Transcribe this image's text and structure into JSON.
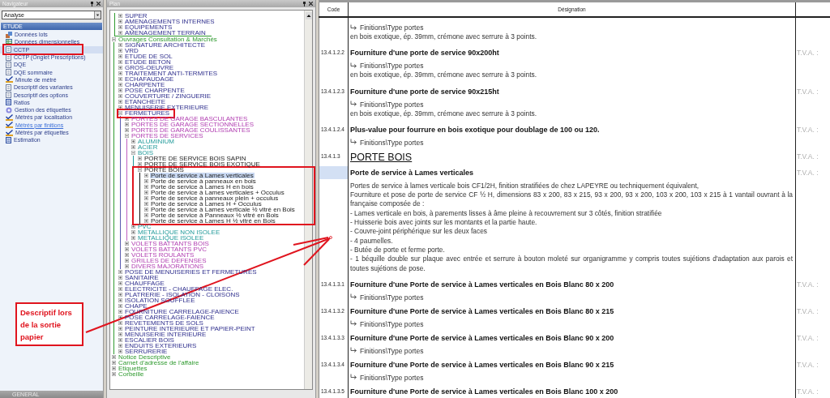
{
  "navigator": {
    "title": "Navigateur",
    "dropdown": {
      "value": "Analyse"
    },
    "section": "ETUDE",
    "items": [
      {
        "label": "Données lots",
        "kind": "lots",
        "selected": false,
        "hovered": false
      },
      {
        "label": "Données dimensionnelles",
        "kind": "grid",
        "selected": false,
        "hovered": false
      },
      {
        "label": "CCTP",
        "kind": "doc",
        "selected": true,
        "hovered": false
      },
      {
        "label": "CCTP (Onglet Prescriptions)",
        "kind": "doc",
        "selected": false,
        "hovered": false
      },
      {
        "label": "DQE",
        "kind": "doc",
        "selected": false,
        "hovered": false
      },
      {
        "label": "DQE sommaire",
        "kind": "doc",
        "selected": false,
        "hovered": false
      },
      {
        "label": "Minute de métré",
        "kind": "measure",
        "selected": false,
        "hovered": false
      },
      {
        "label": "Descriptif des variantes",
        "kind": "doc",
        "selected": false,
        "hovered": false
      },
      {
        "label": "Descriptif des options",
        "kind": "doc",
        "selected": false,
        "hovered": false
      },
      {
        "label": "Ratios",
        "kind": "list",
        "selected": false,
        "hovered": false
      },
      {
        "label": "Gestion des étiquettes",
        "kind": "tag",
        "selected": false,
        "hovered": false
      },
      {
        "label": "Métrés par localisation",
        "kind": "measure",
        "selected": false,
        "hovered": false
      },
      {
        "label": "Métrés par finitions",
        "kind": "measure",
        "selected": false,
        "hovered": true
      },
      {
        "label": "Métrés par étiquettes",
        "kind": "measure",
        "selected": false,
        "hovered": false
      },
      {
        "label": "Estimation",
        "kind": "list",
        "selected": false,
        "hovered": false
      }
    ],
    "footer": "GENERAL"
  },
  "plan": {
    "title": "Plan",
    "top_items": [
      {
        "label": "SUPER",
        "expanded": false,
        "selected": false
      },
      {
        "label": "AMENAGEMENTS INTERNES",
        "expanded": false,
        "selected": false
      },
      {
        "label": "EQUIPEMENTS",
        "expanded": false,
        "selected": false
      },
      {
        "label": "AMENAGEMENT TERRAIN",
        "expanded": false,
        "selected": false
      }
    ],
    "tree": [
      {
        "label": "Ouvrages Consultation & Marchés",
        "expanded": true,
        "selected": false,
        "children": [
          {
            "label": "SIGNATURE ARCHITECTE",
            "expanded": false,
            "selected": false
          },
          {
            "label": "VRD",
            "expanded": false,
            "selected": false
          },
          {
            "label": "ETUDE DE SOL",
            "expanded": false,
            "selected": false
          },
          {
            "label": "ETUDE BETON",
            "expanded": false,
            "selected": false
          },
          {
            "label": "GROS-OEUVRE",
            "expanded": false,
            "selected": false
          },
          {
            "label": "TRAITEMENT ANTI-TERMITES",
            "expanded": false,
            "selected": false
          },
          {
            "label": "ECHAFAUDAGE",
            "expanded": false,
            "selected": false
          },
          {
            "label": "CHARPENTE",
            "expanded": false,
            "selected": false
          },
          {
            "label": "POSE CHARPENTE",
            "expanded": false,
            "selected": false
          },
          {
            "label": "COUVERTURE / ZINGUERIE",
            "expanded": false,
            "selected": false
          },
          {
            "label": "ETANCHEITE",
            "expanded": false,
            "selected": false
          },
          {
            "label": "MENUISERIE EXTERIEURE",
            "expanded": false,
            "selected": false
          },
          {
            "label": "FERMETURES",
            "expanded": true,
            "selected": false,
            "children": [
              {
                "label": "PORTES DE GARAGE BASCULANTES",
                "expanded": false,
                "selected": false
              },
              {
                "label": "PORTES DE GARAGE SECTIONNELLES",
                "expanded": false,
                "selected": false
              },
              {
                "label": "PORTES DE GARAGE COULISSANTES",
                "expanded": false,
                "selected": false
              },
              {
                "label": "PORTES DE SERVICES",
                "expanded": true,
                "selected": false,
                "children": [
                  {
                    "label": "ALUMINIUM",
                    "expanded": false,
                    "selected": false
                  },
                  {
                    "label": "ACIER",
                    "expanded": false,
                    "selected": false
                  },
                  {
                    "label": "BOIS",
                    "expanded": true,
                    "selected": false,
                    "children": [
                      {
                        "label": "PORTE DE SERVICE BOIS SAPIN",
                        "expanded": false,
                        "selected": false
                      },
                      {
                        "label": "PORTE DE SERVICE BOIS EXOTIQUE",
                        "expanded": false,
                        "selected": false
                      },
                      {
                        "label": "PORTE BOIS",
                        "expanded": true,
                        "selected": false,
                        "children": [
                          {
                            "label": "Porte de service à Lames verticales",
                            "expanded": false,
                            "selected": true
                          },
                          {
                            "label": "Porte de service à panneaux en bois",
                            "expanded": false,
                            "selected": false
                          },
                          {
                            "label": "Porte de service à Lames H en bois",
                            "expanded": false,
                            "selected": false
                          },
                          {
                            "label": "Porte de service à Lames verticales + Occulus",
                            "expanded": false,
                            "selected": false
                          },
                          {
                            "label": "Porte de service à panneaux plein + occulus",
                            "expanded": false,
                            "selected": false
                          },
                          {
                            "label": "Porte de service à Lames H + Occulus",
                            "expanded": false,
                            "selected": false
                          },
                          {
                            "label": "Porte de service à Lames verticale ½ vitré en Bois",
                            "expanded": false,
                            "selected": false
                          },
                          {
                            "label": "Porte de service à Panneaux ½ vitré en Bois",
                            "expanded": false,
                            "selected": false
                          },
                          {
                            "label": "Porte de service à Lames H ½ vitré en Bois",
                            "expanded": false,
                            "selected": false
                          }
                        ]
                      }
                    ]
                  },
                  {
                    "label": "PVC",
                    "expanded": false,
                    "selected": false
                  },
                  {
                    "label": "METALLIQUE NON ISOLEE",
                    "expanded": false,
                    "selected": false
                  },
                  {
                    "label": "METALLIQUE ISOLEE",
                    "expanded": false,
                    "selected": false
                  }
                ]
              },
              {
                "label": "VOLETS BATTANTS BOIS",
                "expanded": false,
                "selected": false
              },
              {
                "label": "VOLETS BATTANTS PVC",
                "expanded": false,
                "selected": false
              },
              {
                "label": "VOLETS ROULANTS",
                "expanded": false,
                "selected": false
              },
              {
                "label": "GRILLES DE DEFENSES",
                "expanded": false,
                "selected": false
              },
              {
                "label": "DIVERS MAJORATIONS",
                "expanded": false,
                "selected": false
              }
            ]
          },
          {
            "label": "POSE DE MENUISERIES ET FERMETURES",
            "expanded": false,
            "selected": false
          },
          {
            "label": "SANITAIRE",
            "expanded": false,
            "selected": false
          },
          {
            "label": "CHAUFFAGE",
            "expanded": false,
            "selected": false
          },
          {
            "label": "ELECTRICITE - CHAUFFAGE ELEC.",
            "expanded": false,
            "selected": false
          },
          {
            "label": "PLATRERIE - ISOLATION - CLOISONS",
            "expanded": false,
            "selected": false
          },
          {
            "label": "ISOLATION SOUFFLEE",
            "expanded": false,
            "selected": false
          },
          {
            "label": "CHAPE",
            "expanded": false,
            "selected": false
          },
          {
            "label": "FOURNITURE CARRELAGE-FAIENCE",
            "expanded": false,
            "selected": false
          },
          {
            "label": "POSE CARRELAGE-FAIENCE",
            "expanded": false,
            "selected": false
          },
          {
            "label": "REVETEMENTS DE SOLS",
            "expanded": false,
            "selected": false
          },
          {
            "label": "PEINTURE INTERIEURE ET PAPIER-PEINT",
            "expanded": false,
            "selected": false
          },
          {
            "label": "MENUISERIE INTERIEURE",
            "expanded": false,
            "selected": false
          },
          {
            "label": "ESCALIER BOIS",
            "expanded": false,
            "selected": false
          },
          {
            "label": "ENDUITS EXTERIEURS",
            "expanded": false,
            "selected": false
          },
          {
            "label": "SERRURERIE",
            "expanded": false,
            "selected": false
          }
        ]
      },
      {
        "label": "Notice Descriptive",
        "expanded": false,
        "selected": false
      },
      {
        "label": "Carnet d'adresse de l'affaire",
        "expanded": false,
        "selected": false
      },
      {
        "label": "Etiquettes",
        "expanded": false,
        "selected": false
      },
      {
        "label": "Corbeille",
        "expanded": false,
        "selected": false
      }
    ]
  },
  "document": {
    "columns": [
      "Code",
      "Désignation"
    ],
    "rows": [
      {
        "kind": "item",
        "selected": false,
        "code": "",
        "finitions": "Finitions\\Type portes",
        "lines": [
          "en bois exotique, ép. 39mm, crémone avec serrure à 3 points."
        ]
      },
      {
        "kind": "item",
        "selected": false,
        "code": "13.4.1.2.2",
        "title": "Fourniture d'une porte de service 90x200ht",
        "tva": "T.V.A. :",
        "finitions": "Finitions\\Type portes",
        "lines": [
          "en bois exotique, ép. 39mm, crémone avec serrure à 3 points."
        ]
      },
      {
        "kind": "item",
        "selected": false,
        "code": "13.4.1.2.3",
        "title": "Fourniture d'une porte de service 90x215ht",
        "tva": "T.V.A. :",
        "finitions": "Finitions\\Type portes",
        "lines": [
          "en bois exotique, ép. 39mm, crémone avec serrure à 3 points."
        ]
      },
      {
        "kind": "item",
        "selected": false,
        "code": "13.4.1.2.4",
        "title": "Plus-value pour fourrure en bois exotique pour doublage de 100 ou 120.",
        "tva": "T.V.A. :",
        "finitions": "Finitions\\Type portes"
      },
      {
        "kind": "heading",
        "selected": false,
        "code": "13.4.1.3",
        "title": "PORTE BOIS",
        "tva": "T.V.A. :"
      },
      {
        "kind": "item",
        "selected": true,
        "code": "",
        "title": "Porte de service à Lames verticales",
        "tva": "T.V.A. :",
        "lines": [
          "Portes de service à lames verticale bois CF1/2H, finition stratifiées de chez LAPEYRE ou techniquement équivalent,",
          "Fourniture et pose de porte de service CF ½ H, dimensions 83 x 200, 83 x 215, 93 x 200, 93 x 200, 103 x 200, 103 x 215 à 1 vantail ouvrant à la française composée de :",
          "- Lames verticale en bois, à parements lisses à âme pleine à recouvrement sur 3 côtés, finition stratifiée",
          "- Huisserie bois avec joints sur les montants et la partie haute.",
          "- Couvre-joint périphérique sur les deux faces",
          "- 4 paumelles.",
          "- Butée de porte et ferme porte.",
          "- 1 béquille double sur plaque avec entrée et serrure à bouton moleté sur organigramme y compris toutes sujétions d'adaptation aux parois et toutes sujétions de pose."
        ]
      },
      {
        "kind": "item",
        "selected": false,
        "code": "13.4.1.3.1",
        "title": "Fourniture d'une Porte de service à Lames verticales en Bois Blanc 80 x 200",
        "tva": "T.V.A. :",
        "finitions": "Finitions\\Type portes"
      },
      {
        "kind": "item",
        "selected": false,
        "code": "13.4.1.3.2",
        "title": "Fourniture d'une Porte de service à Lames verticales en Bois Blanc 80 x 215",
        "tva": "T.V.A. :",
        "finitions": "Finitions\\Type portes"
      },
      {
        "kind": "item",
        "selected": false,
        "code": "13.4.1.3.3",
        "title": "Fourniture d'une Porte de service à Lames verticales en Bois Blanc 90 x 200",
        "tva": "T.V.A. :",
        "finitions": "Finitions\\Type portes"
      },
      {
        "kind": "item",
        "selected": false,
        "code": "13.4.1.3.4",
        "title": "Fourniture d'une Porte de service à Lames verticales en Bois Blanc 90 x 215",
        "tva": "T.V.A. :",
        "finitions": "Finitions\\Type portes"
      },
      {
        "kind": "item",
        "selected": false,
        "code": "13.4.1.3.5",
        "title": "Fourniture d'une Porte de service à Lames verticales en Bois Blanc 100 x 200",
        "tva": "T.V.A. :"
      }
    ]
  },
  "annotation": {
    "callout": "Descriptif lors de la sortie papier"
  }
}
